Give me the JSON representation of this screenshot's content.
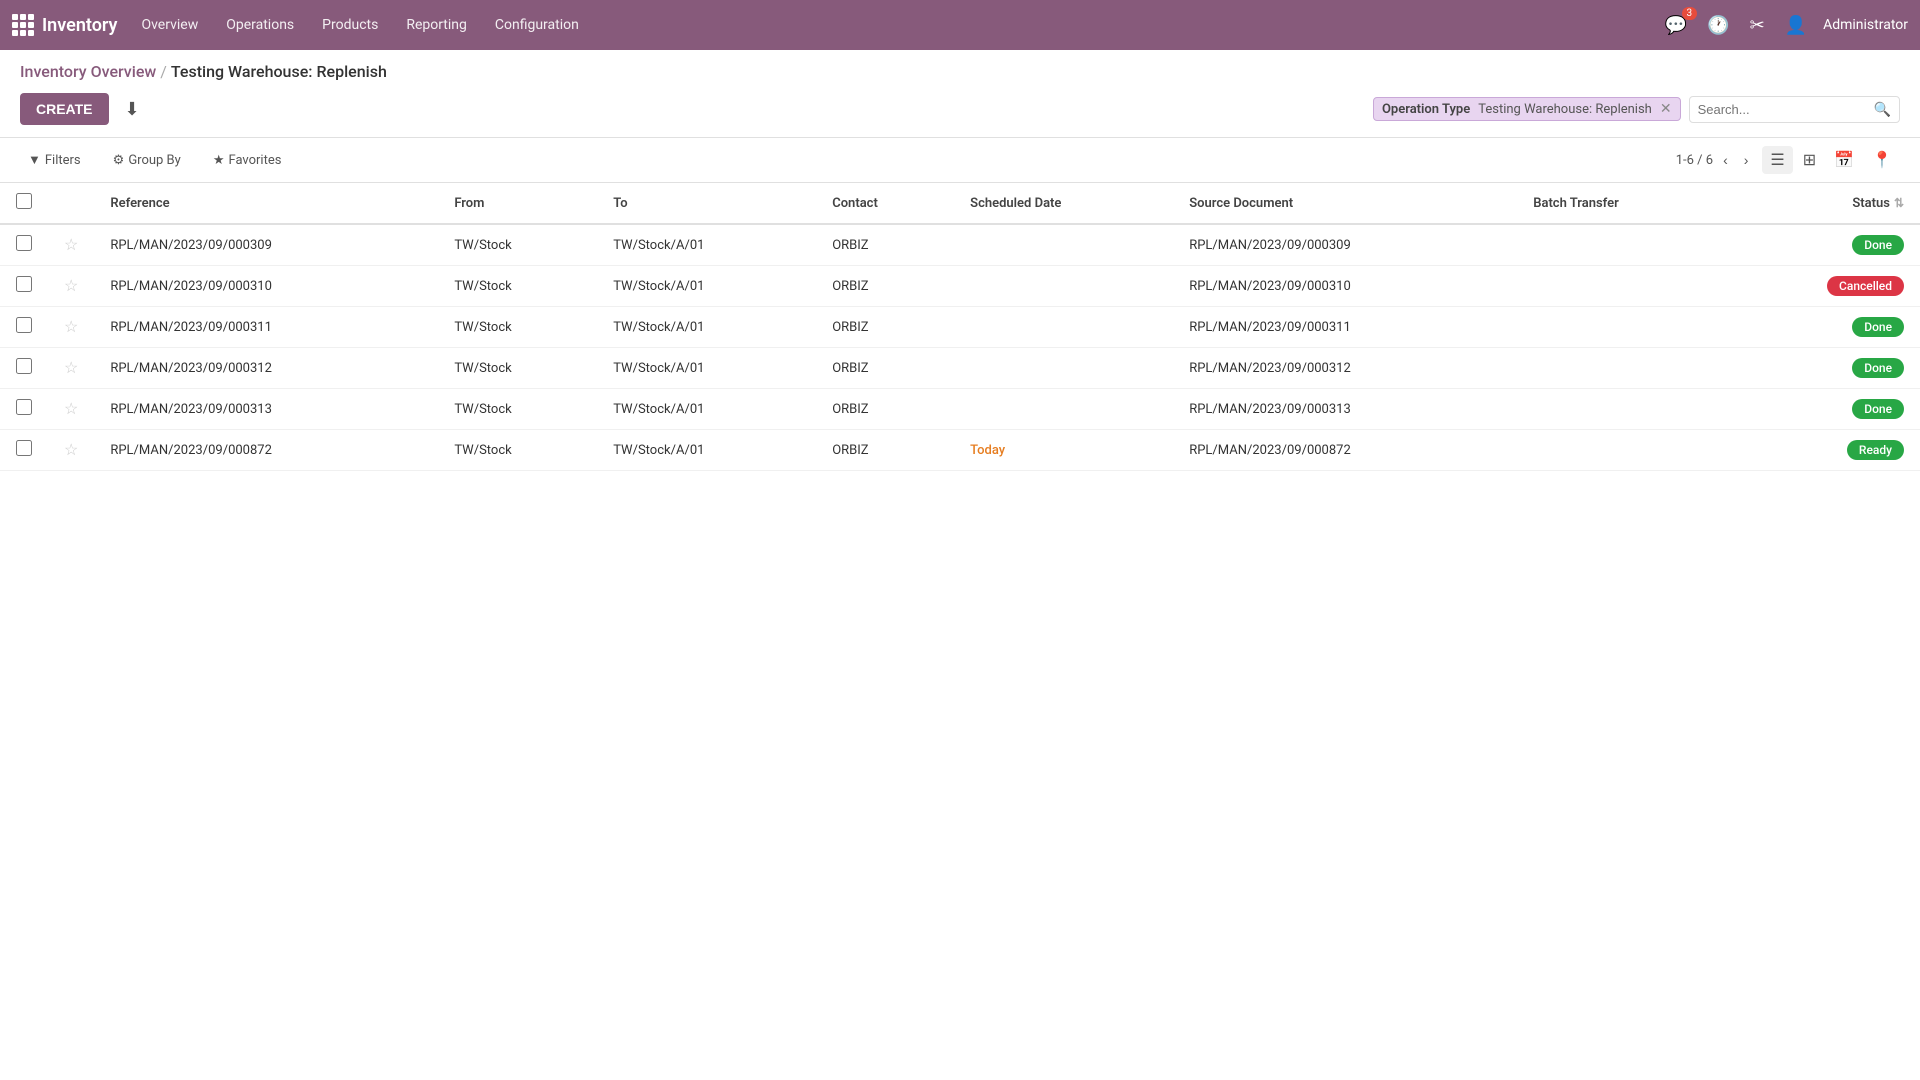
{
  "app": {
    "name": "Inventory",
    "logo_alt": "Odoo"
  },
  "nav": {
    "items": [
      {
        "id": "overview",
        "label": "Overview"
      },
      {
        "id": "operations",
        "label": "Operations"
      },
      {
        "id": "products",
        "label": "Products"
      },
      {
        "id": "reporting",
        "label": "Reporting"
      },
      {
        "id": "configuration",
        "label": "Configuration"
      }
    ]
  },
  "top_nav_right": {
    "chat_badge": "3",
    "admin_label": "Administrator"
  },
  "breadcrumb": {
    "parent": "Inventory Overview",
    "separator": "/",
    "current": "Testing Warehouse: Replenish"
  },
  "toolbar": {
    "create_label": "CREATE",
    "download_tooltip": "Download"
  },
  "filter_area": {
    "operation_type_label": "Operation Type",
    "filter_value": "Testing Warehouse: Replenish",
    "search_placeholder": "Search..."
  },
  "view_controls": {
    "filters_label": "Filters",
    "group_by_label": "Group By",
    "favorites_label": "Favorites",
    "pagination_text": "1-6 / 6"
  },
  "table": {
    "columns": [
      {
        "id": "reference",
        "label": "Reference"
      },
      {
        "id": "from",
        "label": "From"
      },
      {
        "id": "to",
        "label": "To"
      },
      {
        "id": "contact",
        "label": "Contact"
      },
      {
        "id": "scheduled_date",
        "label": "Scheduled Date"
      },
      {
        "id": "source_document",
        "label": "Source Document"
      },
      {
        "id": "batch_transfer",
        "label": "Batch Transfer"
      },
      {
        "id": "status",
        "label": "Status"
      }
    ],
    "rows": [
      {
        "id": 1,
        "reference": "RPL/MAN/2023/09/000309",
        "from": "TW/Stock",
        "to": "TW/Stock/A/01",
        "contact": "ORBIZ",
        "scheduled_date": "",
        "source_document": "RPL/MAN/2023/09/000309",
        "batch_transfer": "",
        "status": "Done",
        "status_class": "badge-done"
      },
      {
        "id": 2,
        "reference": "RPL/MAN/2023/09/000310",
        "from": "TW/Stock",
        "to": "TW/Stock/A/01",
        "contact": "ORBIZ",
        "scheduled_date": "",
        "source_document": "RPL/MAN/2023/09/000310",
        "batch_transfer": "",
        "status": "Cancelled",
        "status_class": "badge-cancelled"
      },
      {
        "id": 3,
        "reference": "RPL/MAN/2023/09/000311",
        "from": "TW/Stock",
        "to": "TW/Stock/A/01",
        "contact": "ORBIZ",
        "scheduled_date": "",
        "source_document": "RPL/MAN/2023/09/000311",
        "batch_transfer": "",
        "status": "Done",
        "status_class": "badge-done"
      },
      {
        "id": 4,
        "reference": "RPL/MAN/2023/09/000312",
        "from": "TW/Stock",
        "to": "TW/Stock/A/01",
        "contact": "ORBIZ",
        "scheduled_date": "",
        "source_document": "RPL/MAN/2023/09/000312",
        "batch_transfer": "",
        "status": "Done",
        "status_class": "badge-done"
      },
      {
        "id": 5,
        "reference": "RPL/MAN/2023/09/000313",
        "from": "TW/Stock",
        "to": "TW/Stock/A/01",
        "contact": "ORBIZ",
        "scheduled_date": "",
        "source_document": "RPL/MAN/2023/09/000313",
        "batch_transfer": "",
        "status": "Done",
        "status_class": "badge-done"
      },
      {
        "id": 6,
        "reference": "RPL/MAN/2023/09/000872",
        "from": "TW/Stock",
        "to": "TW/Stock/A/01",
        "contact": "ORBIZ",
        "scheduled_date": "Today",
        "source_document": "RPL/MAN/2023/09/000872",
        "batch_transfer": "",
        "status": "Ready",
        "status_class": "badge-ready"
      }
    ]
  },
  "icons": {
    "grid": "⊞",
    "chat": "💬",
    "clock": "🕐",
    "wrench": "✂",
    "person": "👤",
    "download": "⬇",
    "search": "🔍",
    "filter": "⊘",
    "group": "⚙",
    "star": "★",
    "star_empty": "☆",
    "list_view": "☰",
    "kanban_view": "⊞",
    "calendar_view": "📅",
    "map_view": "📍",
    "chevron_left": "‹",
    "chevron_right": "›",
    "sort": "⇅"
  }
}
